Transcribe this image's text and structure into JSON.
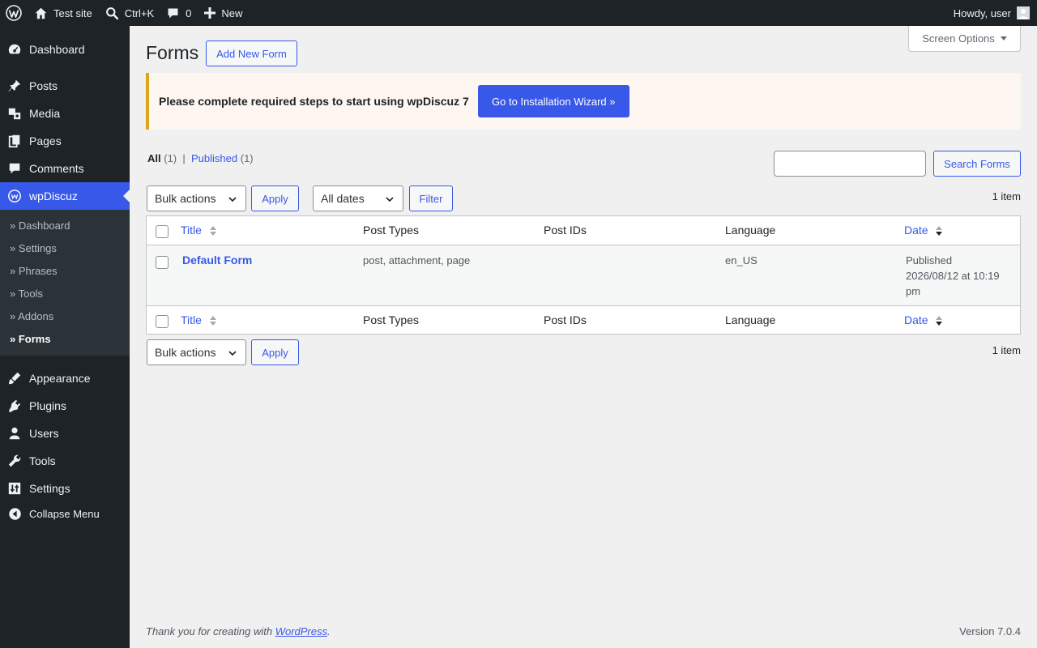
{
  "adminbar": {
    "site_name": "Test site",
    "search_shortcut": "Ctrl+K",
    "comments_count": "0",
    "new_label": "New",
    "howdy": "Howdy, user"
  },
  "sidebar": {
    "items": [
      {
        "label": "Dashboard",
        "icon": "dashboard-icon"
      },
      {
        "label": "Posts",
        "icon": "pin-icon"
      },
      {
        "label": "Media",
        "icon": "media-icon"
      },
      {
        "label": "Pages",
        "icon": "pages-icon"
      },
      {
        "label": "Comments",
        "icon": "comment-icon"
      },
      {
        "label": "wpDiscuz",
        "icon": "wpdiscuz-icon"
      },
      {
        "label": "Appearance",
        "icon": "brush-icon"
      },
      {
        "label": "Plugins",
        "icon": "plugin-icon"
      },
      {
        "label": "Users",
        "icon": "user-icon"
      },
      {
        "label": "Tools",
        "icon": "wrench-icon"
      },
      {
        "label": "Settings",
        "icon": "settings-icon"
      }
    ],
    "submenu": [
      "» Dashboard",
      "» Settings",
      "» Phrases",
      "» Tools",
      "» Addons",
      "» Forms"
    ],
    "collapse_label": "Collapse Menu"
  },
  "page": {
    "title": "Forms",
    "add_new_label": "Add New Form",
    "screen_options_label": "Screen Options"
  },
  "notice": {
    "text": "Please complete required steps to start using wpDiscuz 7",
    "button_label": "Go to Installation Wizard »"
  },
  "views": {
    "all_label": "All",
    "all_count": "(1)",
    "separator": "|",
    "published_label": "Published",
    "published_count": "(1)"
  },
  "search": {
    "button_label": "Search Forms",
    "value": ""
  },
  "tablenav": {
    "bulk_actions": "Bulk actions",
    "apply_label": "Apply",
    "dates_filter": "All dates",
    "filter_label": "Filter",
    "item_count": "1 item"
  },
  "table": {
    "columns": [
      "Title",
      "Post Types",
      "Post IDs",
      "Language",
      "Date"
    ],
    "rows": [
      {
        "title": "Default Form",
        "post_types": "post, attachment, page",
        "post_ids": "",
        "language": "en_US",
        "date_status": "Published",
        "date_value": "2026/08/12 at 10:19",
        "date_suffix": "pm"
      }
    ]
  },
  "footer": {
    "thanks_prefix": "Thank you for creating with ",
    "thanks_link": "WordPress",
    "thanks_suffix": ".",
    "version": "Version 7.0.4"
  },
  "colors": {
    "accent": "#3858e9",
    "adminbar_bg": "#1d2327",
    "notice_border": "#dba617"
  }
}
